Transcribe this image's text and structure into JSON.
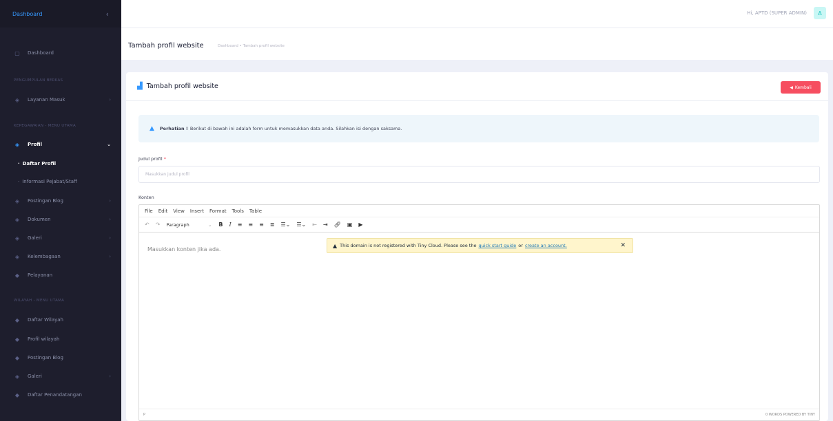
{
  "sidebar": {
    "brand": "Dashboard",
    "toggle_icon": "chevron-left-icon",
    "dashboard": "Dashboard",
    "section_1": "PENGUMPULAN BERKAS",
    "layanan": "Layanan Masuk",
    "section_2": "KEPEGAWAIAN - MENU UTAMA",
    "profil": "Profil",
    "daftar_profil": "Daftar Profil",
    "informasi": "Informasi Pejabat/Staff",
    "postingan": "Postingan Blog",
    "dokumen": "Dokumen",
    "galeri": "Galeri",
    "kelembagaan": "Kelembagaan",
    "pelayanan": "Pelayanan",
    "section_3": "WILAYAH - MENU UTAMA",
    "daftar_wilayah": "Daftar Wilayah",
    "profil_wilayah": "Profil wilayah",
    "postingan_2": "Postingan Blog",
    "galeri_2": "Galeri",
    "penandatangan": "Daftar Penandatangan"
  },
  "header": {
    "user": "Hi, APTD (SUPER ADMIN)",
    "avatar": "A"
  },
  "subheader": {
    "title": "Tambah profil website",
    "breadcrumb": "Dashboard  •  Tambah profil website"
  },
  "card": {
    "title": "Tambah profil website",
    "back_button": "Kembali"
  },
  "alert": {
    "bold": "Perhatian !",
    "text": "Berikut di bawah ini adalah form untuk memasukkan data anda. Silahkan isi dengan saksama."
  },
  "form": {
    "judul_label": "Judul profil",
    "judul_required": "*",
    "judul_placeholder": "Masukkan judul profil",
    "konten_label": "Konten"
  },
  "editor": {
    "menu": [
      "File",
      "Edit",
      "View",
      "Insert",
      "Format",
      "Tools",
      "Table"
    ],
    "block_format": "Paragraph",
    "placeholder": "Masukkan konten jika ada.",
    "notice_text": "This domain is not registered with Tiny Cloud. Please see the",
    "notice_link1": "quick start guide",
    "notice_or": "or",
    "notice_link2": "create an account.",
    "status_left": "P",
    "status_right": "0 WORDS  POWERED BY TINY"
  }
}
